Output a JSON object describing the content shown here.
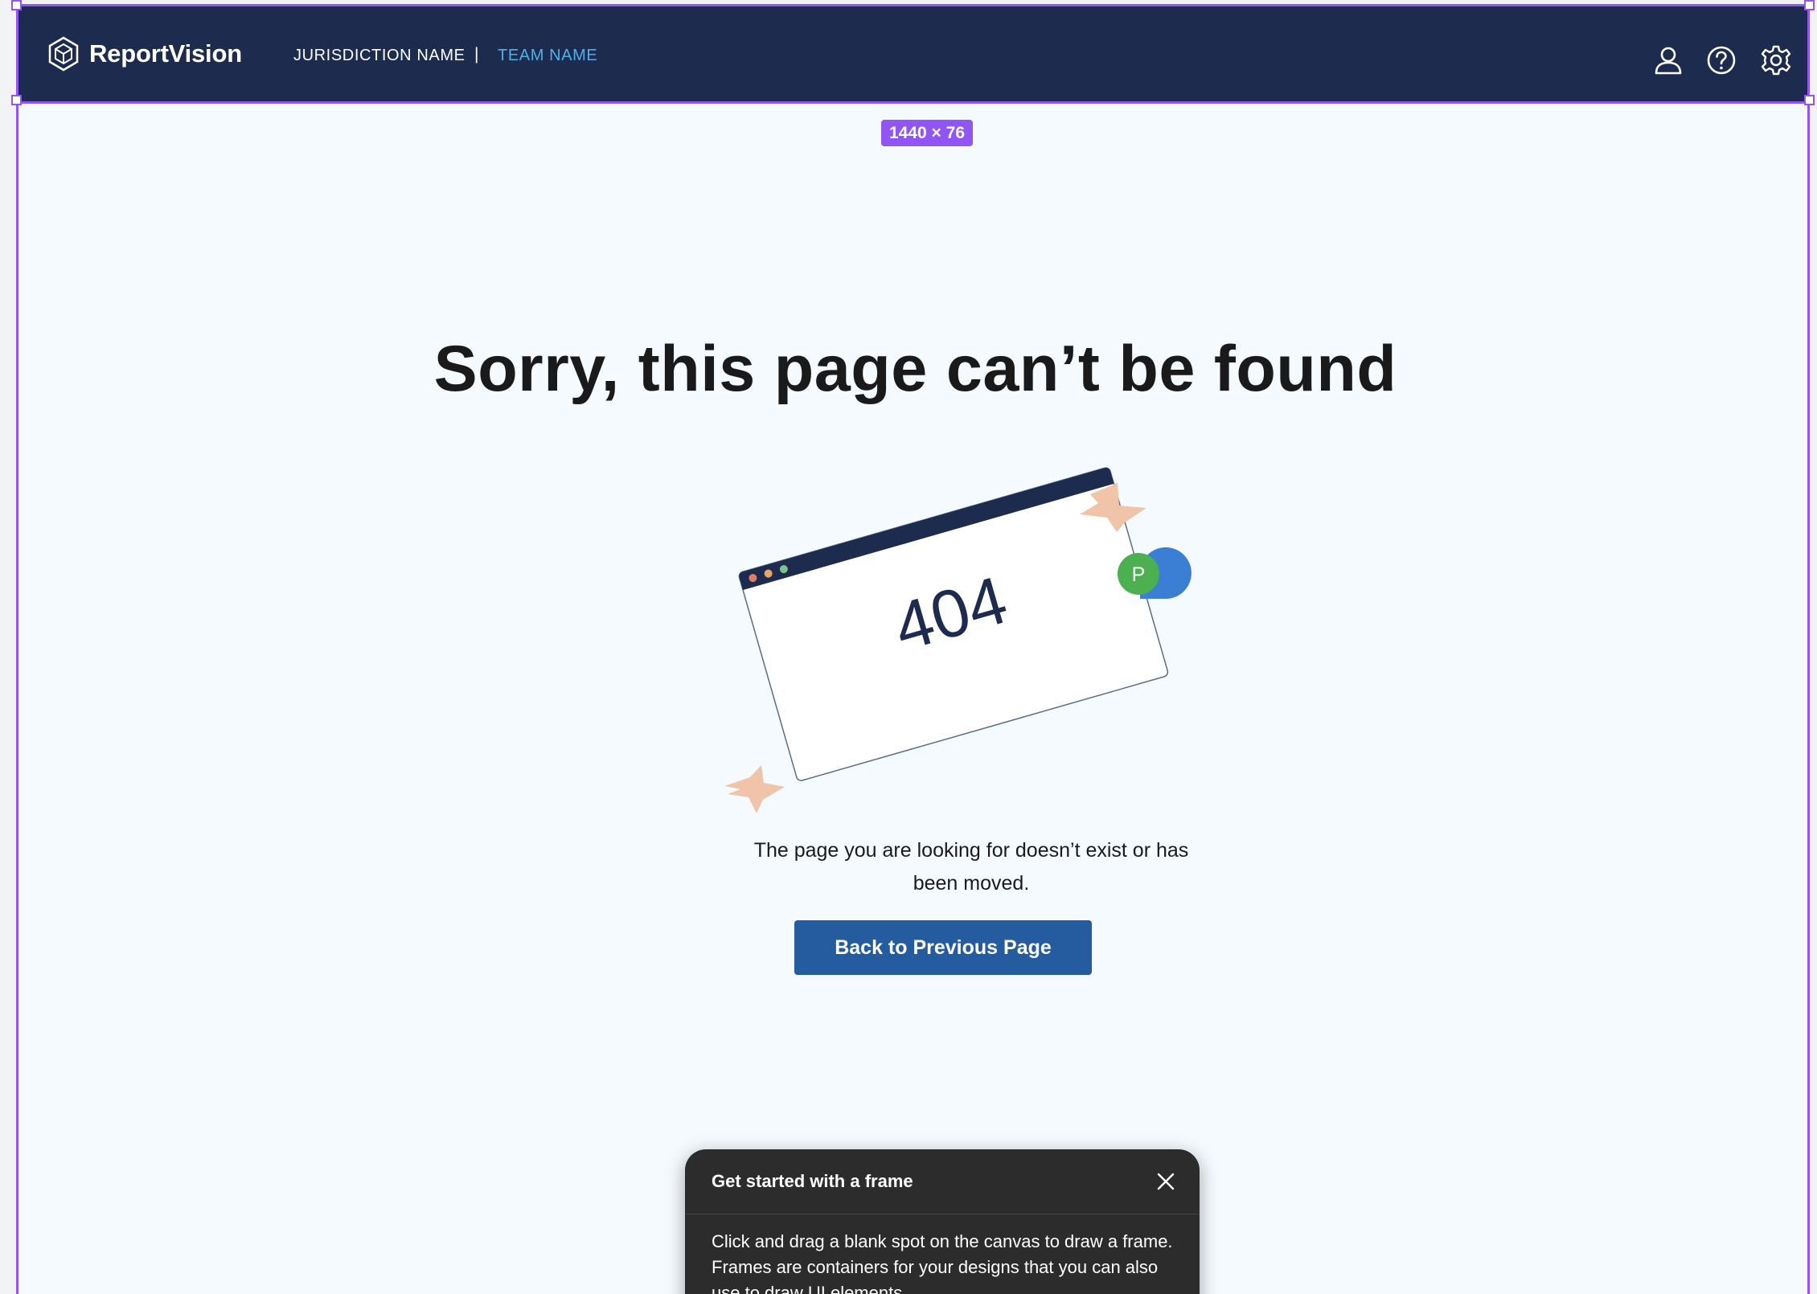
{
  "app": {
    "logo_text": "ReportVision",
    "jurisdiction": "JURISDICTION NAME",
    "separator": "|",
    "team": "TEAM NAME",
    "icons": [
      "user-icon",
      "help-icon",
      "settings-icon"
    ]
  },
  "editor": {
    "frame_size_label": "1440 × 76"
  },
  "main": {
    "title": "Sorry, this page can’t be found",
    "illustration_text": "404",
    "avatar_initial": "P",
    "description": "The page you are looking for doesn’t exist or has been moved.",
    "back_button": "Back to Previous Page"
  },
  "popover": {
    "title": "Get started with a frame",
    "body": "Click and drag a blank spot on the canvas to draw a frame. Frames are containers for your designs that you can also use to draw UI elements."
  },
  "colors": {
    "header_bg": "#1c2b4e",
    "team_accent": "#4fb0e8",
    "page_bg": "#f5faff",
    "button_bg": "#255ca0",
    "selection": "#9055f2",
    "tape": "#f0c4a8",
    "avatar": "#4caf50"
  }
}
